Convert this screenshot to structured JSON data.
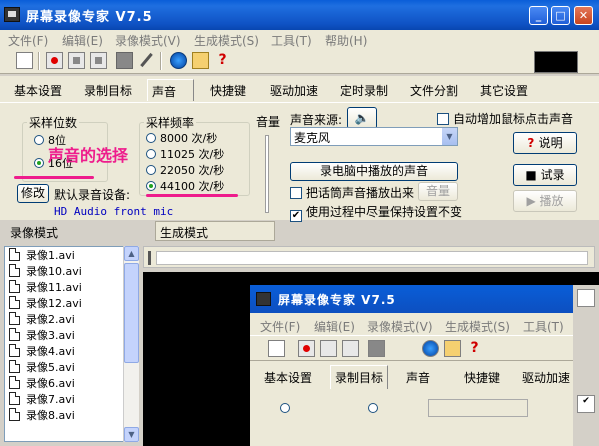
{
  "window": {
    "title": "屏幕录像专家 V7.5"
  },
  "menu": [
    "文件(F)",
    "编辑(E)",
    "录像模式(V)",
    "生成模式(S)",
    "工具(T)",
    "帮助(H)"
  ],
  "tabs": [
    "基本设置",
    "录制目标",
    "声音",
    "快捷键",
    "驱动加速",
    "定时录制",
    "文件分割",
    "其它设置"
  ],
  "sound": {
    "bit_depth": {
      "legend": "采样位数",
      "options": [
        "8位",
        "16位"
      ],
      "selected": "16位"
    },
    "sample_rate": {
      "legend": "采样频率",
      "options": [
        "8000 次/秒",
        "11025 次/秒",
        "22050 次/秒",
        "44100 次/秒"
      ],
      "selected": "44100 次/秒"
    },
    "annotation": "声音的选择",
    "modify_button": "修改",
    "default_device_label": "默认录音设备:",
    "default_device": "HD Audio front mic",
    "volume_label": "音量",
    "source_label": "声音来源:",
    "source_value": "麦克风",
    "record_pc_sound_button": "录电脑中播放的声音",
    "mic_playback_label": "把话筒声音播放出来",
    "mic_volume_button": "音量",
    "keep_settings_label": "使用过程中尽量保持设置不变",
    "keep_settings_checked": true,
    "auto_click_sound_label": "自动增加鼠标点击声音",
    "auto_click_sound_checked": false,
    "help_button": "说明",
    "test_record_button": "试录",
    "play_button": "播放"
  },
  "lower": {
    "record_mode_label": "录像模式",
    "generate_mode_label": "生成模式",
    "files": [
      "录像1.avi",
      "录像10.avi",
      "录像11.avi",
      "录像12.avi",
      "录像2.avi",
      "录像3.avi",
      "录像4.avi",
      "录像5.avi",
      "录像6.avi",
      "录像7.avi",
      "录像8.avi"
    ]
  },
  "inner_window": {
    "title": "屏幕录像专家 V7.5",
    "menu": [
      "文件(F)",
      "编辑(E)",
      "录像模式(V)",
      "生成模式(S)",
      "工具(T)"
    ],
    "tabs": [
      "基本设置",
      "录制目标",
      "声音",
      "快捷键",
      "驱动加速"
    ]
  }
}
